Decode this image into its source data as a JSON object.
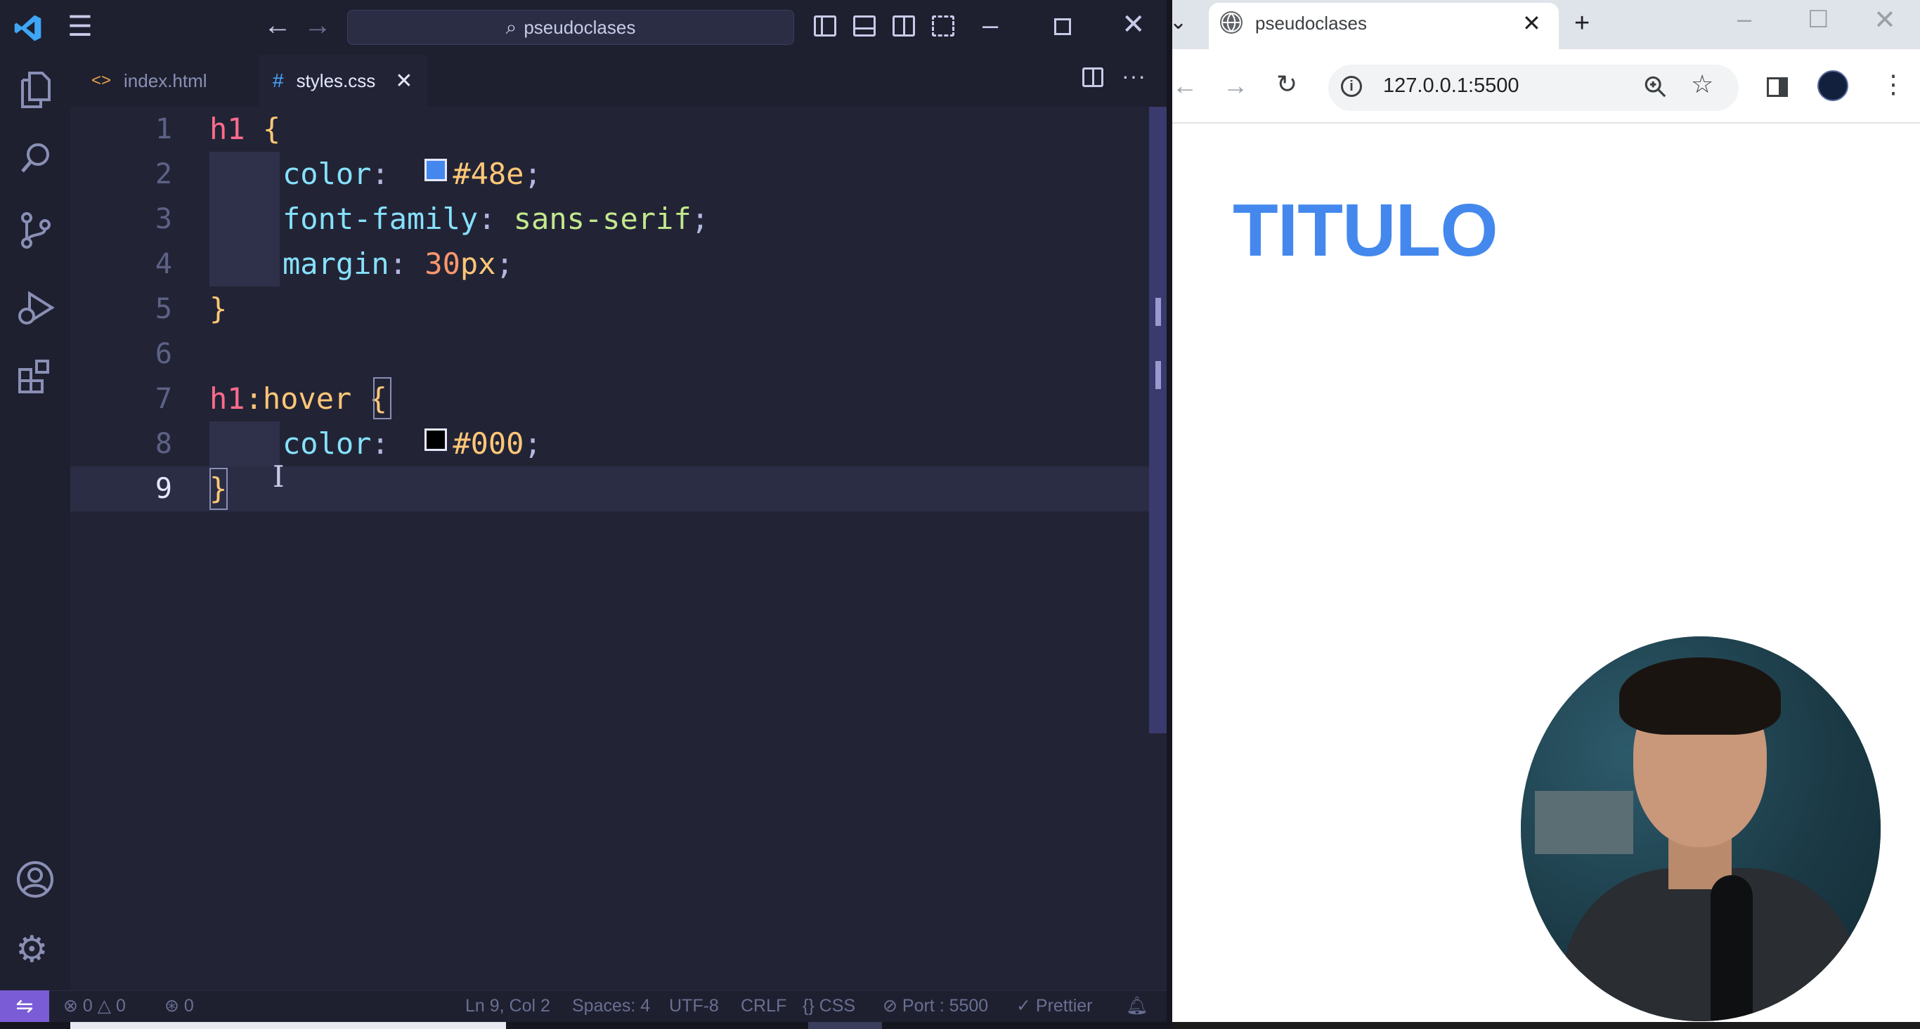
{
  "vscode": {
    "command_center": "pseudoclases",
    "tabs": [
      {
        "label": "index.html",
        "icon": "html-file-icon"
      },
      {
        "label": "styles.css",
        "icon": "css-file-icon"
      }
    ],
    "code_lines": [
      {
        "n": "1"
      },
      {
        "n": "2"
      },
      {
        "n": "3"
      },
      {
        "n": "4"
      },
      {
        "n": "5"
      },
      {
        "n": "6"
      },
      {
        "n": "7"
      },
      {
        "n": "8"
      },
      {
        "n": "9"
      }
    ],
    "code": {
      "l1_sel": "h1",
      "l1_brace": "{",
      "l2_prop": "color",
      "l2_val": "#48e",
      "l3_prop": "font-family",
      "l3_val": "sans-serif",
      "l4_prop": "margin",
      "l4_num": "30",
      "l4_unit": "px",
      "l5_brace": "}",
      "l7_sel": "h1",
      "l7_pseudo": ":hover",
      "l7_brace": "{",
      "l8_prop": "color",
      "l8_val": "#000",
      "l9_brace": "}"
    },
    "swatch_colors": {
      "l2": "#4488ee",
      "l8": "#000000"
    },
    "status": {
      "errors": "0",
      "warnings": "0",
      "ports": "0",
      "position": "Ln 9, Col 2",
      "spaces": "Spaces: 4",
      "encoding": "UTF-8",
      "eol": "CRLF",
      "language": "CSS",
      "port": "Port : 5500",
      "formatter": "Prettier"
    }
  },
  "browser": {
    "tab_title": "pseudoclases",
    "url": "127.0.0.1:5500",
    "page_heading": "TITULO",
    "heading_color": "#4488ee"
  }
}
